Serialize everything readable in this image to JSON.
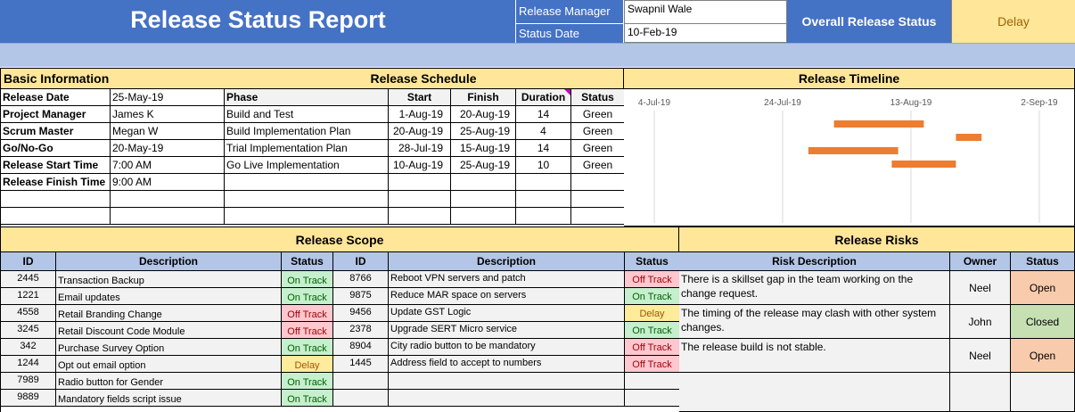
{
  "header": {
    "title": "Release Status Report",
    "release_manager_label": "Release Manager",
    "release_manager_value": "Swapnil Wale",
    "status_date_label": "Status Date",
    "status_date_value": "10-Feb-19",
    "overall_label": "Overall Release Status",
    "overall_value": "Delay"
  },
  "basic_info": {
    "title": "Basic Information",
    "rows": [
      {
        "label": "Release Date",
        "value": "25-May-19"
      },
      {
        "label": "Project Manager",
        "value": "James K"
      },
      {
        "label": "Scrum Master",
        "value": "Megan W"
      },
      {
        "label": "Go/No-Go",
        "value": "20-May-19"
      },
      {
        "label": "Release Start Time",
        "value": "7:00 AM"
      },
      {
        "label": "Release Finish Time",
        "value": "9:00 AM"
      }
    ]
  },
  "schedule": {
    "title": "Release Schedule",
    "headers": {
      "phase": "Phase",
      "start": "Start",
      "finish": "Finish",
      "duration": "Duration",
      "status": "Status"
    },
    "rows": [
      {
        "phase": "Build and Test",
        "start": "1-Aug-19",
        "finish": "20-Aug-19",
        "duration": "14",
        "status": "Green"
      },
      {
        "phase": "Build Implementation Plan",
        "start": "20-Aug-19",
        "finish": "25-Aug-19",
        "duration": "4",
        "status": "Green"
      },
      {
        "phase": "Trial Implementation Plan",
        "start": "28-Jul-19",
        "finish": "15-Aug-19",
        "duration": "14",
        "status": "Green"
      },
      {
        "phase": "Go Live Implementation",
        "start": "10-Aug-19",
        "finish": "25-Aug-19",
        "duration": "10",
        "status": "Green"
      }
    ]
  },
  "timeline": {
    "title": "Release Timeline",
    "ticks": [
      "4-Jul-19",
      "24-Jul-19",
      "13-Aug-19",
      "2-Sep-19"
    ],
    "bar_color": "#ed7d31"
  },
  "chart_data": {
    "type": "bar",
    "orientation": "horizontal-gantt",
    "title": "Release Timeline",
    "x_ticks": [
      "4-Jul-19",
      "24-Jul-19",
      "13-Aug-19",
      "2-Sep-19"
    ],
    "xlim": [
      "4-Jul-19",
      "2-Sep-19"
    ],
    "grid": true,
    "series": [
      {
        "start": "2019-08-01",
        "finish": "2019-08-15"
      },
      {
        "start": "2019-08-20",
        "finish": "2019-08-24"
      },
      {
        "start": "2019-07-28",
        "finish": "2019-08-11"
      },
      {
        "start": "2019-08-10",
        "finish": "2019-08-20"
      }
    ]
  },
  "scope": {
    "title": "Release Scope",
    "headers": {
      "id": "ID",
      "description": "Description",
      "status": "Status"
    },
    "left": [
      {
        "id": "2445",
        "description": "Transaction Backup",
        "status": "On Track",
        "kind": "green"
      },
      {
        "id": "1221",
        "description": "Email updates",
        "status": "On Track",
        "kind": "green"
      },
      {
        "id": "4558",
        "description": "Retail Branding Change",
        "status": "Off Track",
        "kind": "red"
      },
      {
        "id": "3245",
        "description": "Retail Discount Code Module",
        "status": "Off Track",
        "kind": "red"
      },
      {
        "id": "342",
        "description": "Purchase Survey Option",
        "status": "On Track",
        "kind": "green"
      },
      {
        "id": "1244",
        "description": "Opt out email option",
        "status": "Delay",
        "kind": "amber"
      },
      {
        "id": "7989",
        "description": "Radio button for Gender",
        "status": "On Track",
        "kind": "green"
      },
      {
        "id": "9889",
        "description": "Mandatory fields script issue",
        "status": "On Track",
        "kind": "green"
      }
    ],
    "right": [
      {
        "id": "8766",
        "description": "Reboot VPN servers and patch",
        "status": "Off Track",
        "kind": "red"
      },
      {
        "id": "9875",
        "description": "Reduce MAR space on servers",
        "status": "On Track",
        "kind": "green"
      },
      {
        "id": "9456",
        "description": "Update GST Logic",
        "status": "Delay",
        "kind": "amber"
      },
      {
        "id": "2378",
        "description": "Upgrade SERT Micro service",
        "status": "On Track",
        "kind": "green"
      },
      {
        "id": "8904",
        "description": "City radio button to be mandatory",
        "status": "Off Track",
        "kind": "red"
      },
      {
        "id": "1445",
        "description": "Address field to accept to numbers",
        "status": "Off Track",
        "kind": "red"
      }
    ]
  },
  "risks": {
    "title": "Release Risks",
    "headers": {
      "description": "Risk Description",
      "owner": "Owner",
      "status": "Status"
    },
    "rows": [
      {
        "description_line1": "There is a skillset gap in the team working on the",
        "description_line2": "change request.",
        "owner": "Neel",
        "status": "Open",
        "kind": "open"
      },
      {
        "description_line1": "The timing of the release may clash with other system",
        "description_line2": "changes.",
        "owner": "John",
        "status": "Closed",
        "kind": "closed"
      },
      {
        "description_line1": "The release build is not stable.",
        "description_line2": "",
        "owner": "Neel",
        "status": "Open",
        "kind": "open"
      }
    ]
  }
}
